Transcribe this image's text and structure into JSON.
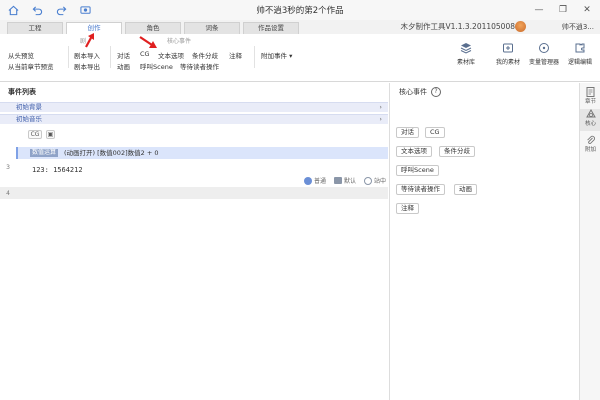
{
  "window": {
    "title": "帅不逍3秒的第2个作品",
    "controls": [
      "minimize-icon",
      "restore-icon",
      "close-icon"
    ]
  },
  "toolbar_icons": [
    "home-icon",
    "undo-icon",
    "redo-icon",
    "preview-icon"
  ],
  "tabs": [
    {
      "label": "工程",
      "active": false
    },
    {
      "label": "创作",
      "active": true
    },
    {
      "label": "角色",
      "active": false
    },
    {
      "label": "词条",
      "active": false
    },
    {
      "label": "作品设置",
      "active": false
    }
  ],
  "header": {
    "version": "木夕制作工具V1.1.3.201105008",
    "username": "帅不逍3..."
  },
  "ribbon": {
    "group_script_label": "剧",
    "group_core_label": "核心事件",
    "play_from_start": "从头预览",
    "play_from_chapter": "从当前章节预览",
    "import_script": "剧本导入",
    "export_script": "剧本导出",
    "core_items": [
      "对话",
      "CG",
      "文本选项",
      "条件分歧",
      "注释"
    ],
    "core_items_row2": [
      "动画",
      "呼叫Scene",
      "等待读者操作"
    ],
    "extra_event": "附加事件",
    "right_buttons": [
      {
        "label": "素材库",
        "icon": "layers-icon"
      },
      {
        "label": "我的素材",
        "icon": "folder-icon"
      },
      {
        "label": "变量管理器",
        "icon": "gauge-icon"
      },
      {
        "label": "逻辑编辑",
        "icon": "puzzle-icon"
      }
    ],
    "accent": "#e02020"
  },
  "event_list": {
    "title": "事件列表",
    "rows": [
      {
        "label": "初始背景"
      },
      {
        "label": "初始音乐"
      }
    ],
    "chips": [
      "CG",
      "▣"
    ],
    "selected_row": {
      "tag": "数值运算",
      "text": "(动画打开) [数值002]数值2 + 0"
    },
    "line_numbers": [
      "3",
      "4"
    ],
    "row3_text": "123: 1564212",
    "row3_controls": [
      "普通",
      "默认",
      "站中"
    ]
  },
  "core_panel": {
    "title": "核心事件",
    "help": "?",
    "buttons": [
      "对话",
      "CG",
      "文本选项",
      "条件分歧",
      "呼叫Scene",
      "等待读者操作",
      "动画",
      "注释"
    ]
  },
  "vertical_tabs": [
    {
      "label": "章节",
      "icon": "document-icon",
      "active": false
    },
    {
      "label": "核心",
      "icon": "shapes-icon",
      "active": true
    },
    {
      "label": "附加",
      "icon": "clip-icon",
      "active": false
    }
  ]
}
